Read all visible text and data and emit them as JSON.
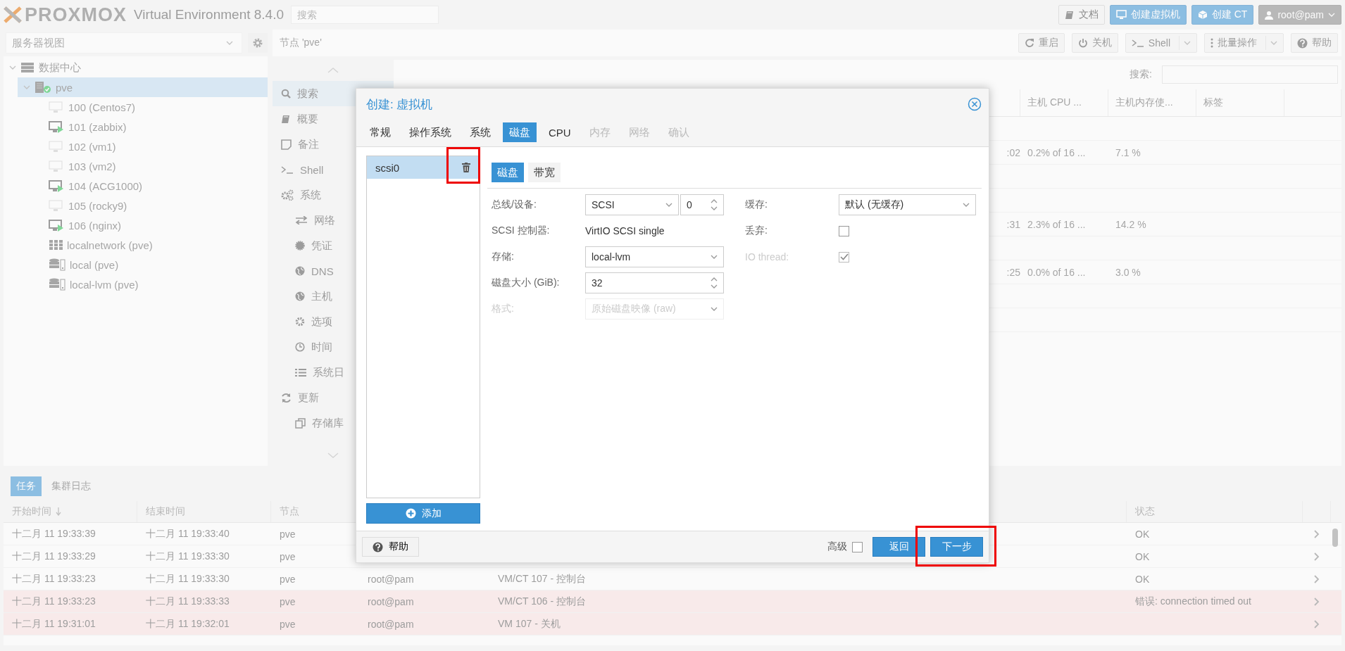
{
  "topbar": {
    "logo": "PROXMOX",
    "product": "Virtual Environment 8.4.0",
    "search": {
      "placeholder": "搜索"
    },
    "buttons": [
      {
        "kind": "docs",
        "label": "文档"
      },
      {
        "kind": "create_vm",
        "label": "创建虚拟机"
      },
      {
        "kind": "create_ct",
        "label": "创建 CT"
      },
      {
        "kind": "user",
        "label": "root@pam"
      }
    ]
  },
  "sidebar": {
    "view": "服务器视图",
    "tree": [
      {
        "kind": "datacenter",
        "label": "数据中心",
        "expanded": true,
        "selected": false,
        "children": [
          {
            "kind": "node",
            "label": "pve",
            "expanded": true,
            "selected": true,
            "children": [
              {
                "kind": "vm",
                "label": "100 (Centos7)",
                "running": false,
                "selected": false
              },
              {
                "kind": "vm",
                "label": "101 (zabbix)",
                "running": true,
                "selected": false
              },
              {
                "kind": "vm",
                "label": "102 (vm1)",
                "running": false,
                "selected": false
              },
              {
                "kind": "vm",
                "label": "103 (vm2)",
                "running": false,
                "selected": false
              },
              {
                "kind": "vm",
                "label": "104 (ACG1000)",
                "running": true,
                "selected": false
              },
              {
                "kind": "vm",
                "label": "105 (rocky9)",
                "running": false,
                "selected": false
              },
              {
                "kind": "vm",
                "label": "106 (nginx)",
                "running": true,
                "selected": false
              },
              {
                "kind": "sdn",
                "label": "localnetwork (pve)",
                "selected": false
              },
              {
                "kind": "storage",
                "label": "local (pve)",
                "selected": false
              },
              {
                "kind": "storage",
                "label": "local-lvm (pve)",
                "selected": false
              }
            ]
          }
        ]
      }
    ]
  },
  "content": {
    "title": "节点 'pve'",
    "toolbar": [
      {
        "kind": "reboot",
        "label": "重启"
      },
      {
        "kind": "shutdown",
        "label": "关机"
      },
      {
        "kind": "shell",
        "label": "Shell"
      },
      {
        "kind": "bulk",
        "label": "批量操作"
      },
      {
        "kind": "help",
        "label": "帮助"
      }
    ],
    "menu": [
      {
        "kind": "search",
        "label": "搜索",
        "selected": true
      },
      {
        "kind": "summary",
        "label": "概要",
        "selected": false
      },
      {
        "kind": "notes",
        "label": "备注",
        "selected": false
      },
      {
        "kind": "shell",
        "label": "Shell",
        "selected": false
      },
      {
        "kind": "system",
        "label": "系统",
        "selected": false,
        "children": [
          {
            "kind": "network",
            "label": "网络",
            "selected": false
          },
          {
            "kind": "certificate",
            "label": "凭证",
            "selected": false
          },
          {
            "kind": "dns",
            "label": "DNS",
            "selected": false
          },
          {
            "kind": "hosts",
            "label": "主机",
            "selected": false
          },
          {
            "kind": "options",
            "label": "选项",
            "selected": false
          },
          {
            "kind": "time",
            "label": "时间",
            "selected": false
          },
          {
            "kind": "syslog",
            "label": "系统日",
            "selected": false
          }
        ]
      },
      {
        "kind": "updates",
        "label": "更新",
        "selected": false,
        "children": [
          {
            "kind": "repositories",
            "label": "存储库",
            "selected": false
          }
        ]
      }
    ],
    "search_label": "搜索:",
    "grid": {
      "columns": [
        "主机 CPU ...",
        "主机内存使...",
        "标签"
      ],
      "rows": [
        {
          "kind": "blank"
        },
        {
          "kind": "data",
          "column_1": ":02",
          "cpu": "0.2% of 16 ...",
          "memory": "7.1 %"
        },
        {
          "kind": "blank"
        },
        {
          "kind": "blank"
        },
        {
          "kind": "data",
          "column_1": ":31",
          "cpu": "2.3% of 16 ...",
          "memory": "14.2 %"
        },
        {
          "kind": "blank"
        },
        {
          "kind": "data",
          "column_1": ":25",
          "cpu": "0.0% of 16 ...",
          "memory": "3.0 %"
        },
        {
          "kind": "blank"
        },
        {
          "kind": "blank"
        }
      ]
    }
  },
  "tasks": {
    "tabs": [
      {
        "label": "任务",
        "selected": true
      },
      {
        "label": "集群日志",
        "selected": false
      }
    ],
    "columns": [
      {
        "label": "开始时间",
        "sorted": true
      },
      {
        "label": "结束时间",
        "sorted": false
      },
      {
        "label": "节点",
        "sorted": false
      },
      {
        "label": "状态",
        "sorted": false
      }
    ],
    "rows": [
      {
        "start": "十二月 11 19:33:39",
        "end": "十二月 11 19:33:40",
        "node": "pve",
        "status": "OK",
        "error": false
      },
      {
        "start": "十二月 11 19:33:29",
        "end": "十二月 11 19:33:30",
        "node": "pve",
        "status": "OK",
        "error": false
      },
      {
        "start": "十二月 11 19:33:23",
        "end": "十二月 11 19:33:30",
        "node": "pve",
        "user": "root@pam",
        "description": "VM/CT 107 - 控制台",
        "status": "OK",
        "error": false
      },
      {
        "start": "十二月 11 19:33:23",
        "end": "十二月 11 19:33:33",
        "node": "pve",
        "user": "root@pam",
        "description": "VM/CT 106 - 控制台",
        "status": "错误: connection timed out",
        "error": true
      },
      {
        "start": "十二月 11 19:31:01",
        "end": "十二月 11 19:32:01",
        "node": "pve",
        "user": "root@pam",
        "description": "VM 107 - 关机",
        "error": true
      }
    ]
  },
  "dialog": {
    "title": "创建: 虚拟机",
    "tabs": [
      {
        "label": "常规",
        "selected": false,
        "disabled": false
      },
      {
        "label": "操作系统",
        "selected": false,
        "disabled": false
      },
      {
        "label": "系统",
        "selected": false,
        "disabled": false
      },
      {
        "label": "磁盘",
        "selected": true,
        "disabled": false
      },
      {
        "label": "CPU",
        "selected": false,
        "disabled": false
      },
      {
        "label": "内存",
        "selected": false,
        "disabled": true
      },
      {
        "label": "网络",
        "selected": false,
        "disabled": true
      },
      {
        "label": "确认",
        "selected": false,
        "disabled": true
      }
    ],
    "disks": [
      {
        "label": "scsi0",
        "selected": true,
        "highlighted": true
      }
    ],
    "add_button": "添加",
    "subtabs": [
      {
        "label": "磁盘",
        "selected": true
      },
      {
        "label": "带宽",
        "selected": false
      }
    ],
    "left_fields": [
      {
        "kind": "select_spin",
        "label": "总线/设备:",
        "value": "SCSI",
        "number": "0",
        "disabled": false
      },
      {
        "kind": "text",
        "label": "SCSI 控制器:",
        "value": "VirtIO SCSI single",
        "disabled": false
      },
      {
        "kind": "select",
        "label": "存储:",
        "value": "local-lvm",
        "disabled": false
      },
      {
        "kind": "spin",
        "label": "磁盘大小 (GiB):",
        "value": "32",
        "disabled": false
      },
      {
        "kind": "select",
        "label": "格式:",
        "value": "原始磁盘映像 (raw)",
        "disabled": true
      }
    ],
    "right_fields": [
      {
        "kind": "select",
        "label": "缓存:",
        "value": "默认 (无缓存)",
        "disabled": false
      },
      {
        "kind": "checkbox",
        "label": "丢弃:",
        "checked": false,
        "disabled": false
      },
      {
        "kind": "checkbox",
        "label": "IO thread:",
        "checked": true,
        "disabled": true
      }
    ],
    "help_button": "帮助",
    "advanced": {
      "label": "高级",
      "checked": false
    },
    "buttons": [
      {
        "label": "返回"
      },
      {
        "label": "下一步",
        "highlighted": true
      }
    ]
  }
}
